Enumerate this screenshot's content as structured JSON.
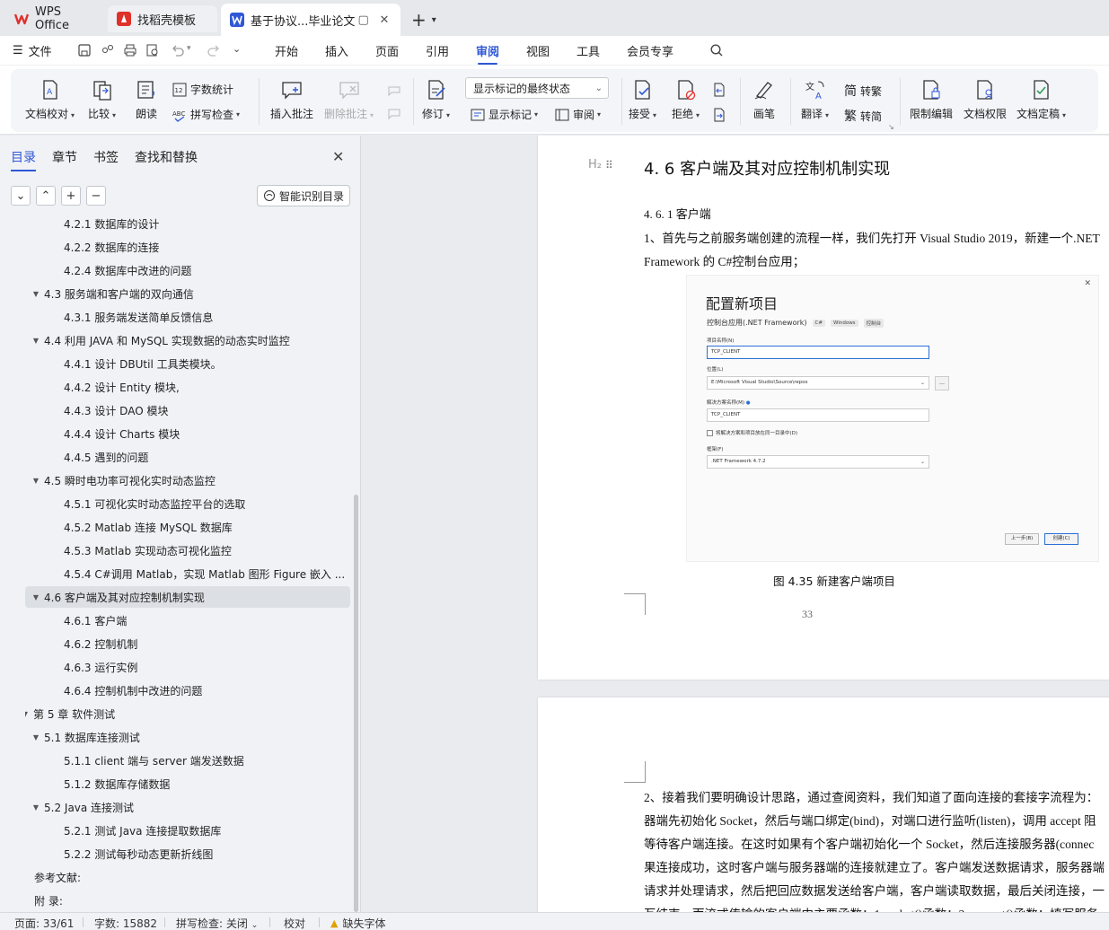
{
  "tabs": [
    {
      "label": "WPS Office"
    },
    {
      "label": "找稻壳模板"
    },
    {
      "label": "基于协议...毕业论文"
    }
  ],
  "menu": {
    "file": "文件",
    "items": [
      "开始",
      "插入",
      "页面",
      "引用",
      "审阅",
      "视图",
      "工具",
      "会员专享"
    ],
    "active": "审阅"
  },
  "ribbon": {
    "doc_check": "文档校对",
    "compare": "比较",
    "read_aloud": "朗读",
    "word_count": "字数统计",
    "spell_check": "拼写检查",
    "insert_comment": "插入批注",
    "delete_comment": "删除批注",
    "revise": "修订",
    "markup_state": "显示标记的最终状态",
    "show_markup": "显示标记",
    "review": "审阅",
    "accept": "接受",
    "reject": "拒绝",
    "ink": "画笔",
    "translate": "翻译",
    "to_traditional": "转繁",
    "to_simplified": "转简",
    "restrict_edit": "限制编辑",
    "doc_permission": "文档权限",
    "finalize": "文档定稿"
  },
  "left_panel": {
    "tabs": [
      "目录",
      "章节",
      "书签",
      "查找和替换"
    ],
    "smart_toc": "智能识别目录",
    "toc": [
      {
        "level": 2,
        "text": "4.2.1 数据库的设计"
      },
      {
        "level": 2,
        "text": "4.2.2 数据库的连接"
      },
      {
        "level": 2,
        "text": "4.2.4 数据库中改进的问题"
      },
      {
        "level": 1,
        "text": "4.3 服务端和客户端的双向通信",
        "expanded": true
      },
      {
        "level": 2,
        "text": "4.3.1 服务端发送简单反馈信息"
      },
      {
        "level": 1,
        "text": "4.4 利用 JAVA 和 MySQL 实现数据的动态实时监控",
        "expanded": true
      },
      {
        "level": 2,
        "text": "4.4.1 设计 DBUtil 工具类模块。"
      },
      {
        "level": 2,
        "text": "4.4.2 设计 Entity 模块,"
      },
      {
        "level": 2,
        "text": "4.4.3 设计 DAO 模块"
      },
      {
        "level": 2,
        "text": "4.4.4 设计 Charts 模块"
      },
      {
        "level": 2,
        "text": "4.4.5 遇到的问题"
      },
      {
        "level": 1,
        "text": "4.5  瞬时电功率可视化实时动态监控",
        "expanded": true
      },
      {
        "level": 2,
        "text": "4.5.1  可视化实时动态监控平台的选取"
      },
      {
        "level": 2,
        "text": "4.5.2 Matlab 连接 MySQL 数据库"
      },
      {
        "level": 2,
        "text": "4.5.3 Matlab 实现动态可视化监控"
      },
      {
        "level": 2,
        "text": "4.5.4 C#调用 Matlab，实现 Matlab 图形 Figure 嵌入 ..."
      },
      {
        "level": 1,
        "text": "4.6 客户端及其对应控制机制实现",
        "expanded": true,
        "selected": true
      },
      {
        "level": 2,
        "text": "4.6.1  客户端"
      },
      {
        "level": 2,
        "text": "4.6.2  控制机制"
      },
      {
        "level": 2,
        "text": "4.6.3  运行实例"
      },
      {
        "level": 2,
        "text": "4.6.4  控制机制中改进的问题"
      },
      {
        "level": 0,
        "text": "第 5 章  软件测试",
        "expanded": true
      },
      {
        "level": 1,
        "text": "5.1 数据库连接测试",
        "expanded": true
      },
      {
        "level": 2,
        "text": "5.1.1 client 端与 server 端发送数据"
      },
      {
        "level": 2,
        "text": "5.1.2  数据库存储数据"
      },
      {
        "level": 1,
        "text": "5.2 Java 连接测试",
        "expanded": true
      },
      {
        "level": 2,
        "text": "5.2.1 测试 Java 连接提取数据库"
      },
      {
        "level": 2,
        "text": "5.2.2  测试每秒动态更新折线图"
      },
      {
        "level": 0,
        "text": "参考文献:"
      },
      {
        "level": 0,
        "text": "附  录:"
      }
    ]
  },
  "document": {
    "section_title": "4. 6 客户端及其对应控制机制实现",
    "subsection": "4. 6. 1  客户端",
    "para1_line1": "1、首先与之前服务端创建的流程一样，我们先打开 Visual Studio 2019，新建一个.NET",
    "para1_line2": "Framework 的 C#控制台应用；",
    "figure": {
      "title": "配置新项目",
      "subtitle": "控制台应用(.NET Framework)",
      "chips": [
        "C#",
        "Windows",
        "控制台"
      ],
      "project_name_label": "项目名称(N)",
      "project_name": "TCP_CLIENT",
      "location_label": "位置(L)",
      "location": "E:\\Microsoft Visual Studio\\Source\\repos",
      "solution_label": "解决方案名称(M)",
      "solution": "TCP_CLIENT",
      "same_dir": "将解决方案和项目放在同一目录中(D)",
      "framework_label": "框架(F)",
      "framework": ".NET Framework 4.7.2",
      "back_btn": "上一步(B)",
      "create_btn": "创建(C)"
    },
    "caption": "图 4.35  新建客户端项目",
    "page_number": "33",
    "page2_lines": [
      "2、接着我们要明确设计思路，通过查阅资料，我们知道了面向连接的套接字流程为：",
      "器端先初始化 Socket，然后与端口绑定(bind)，对端口进行监听(listen)，调用 accept 阻",
      "等待客户端连接。在这时如果有个客户端初始化一个 Socket，然后连接服务器(connec",
      "果连接成功，这时客户端与服务器端的连接就建立了。客户端发送数据请求，服务器端",
      "请求并处理请求，然后把回应数据发送给客户端，客户端读取数据，最后关闭连接，一",
      "互结束。而流式传输的客户端中主要函数：1.socket()函数；2.connect()函数；填写服务"
    ]
  },
  "status": {
    "page": "页面: 33/61",
    "words": "字数: 15882",
    "spell": "拼写检查: 关闭",
    "proof": "校对",
    "missing_font": "缺失字体"
  }
}
